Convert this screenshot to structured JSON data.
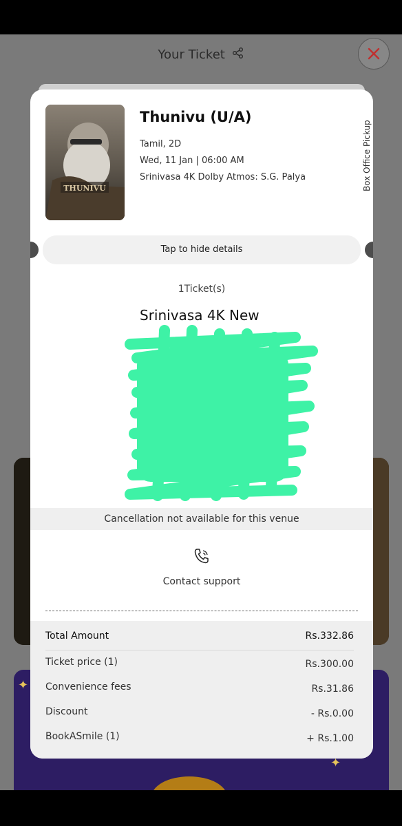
{
  "header": {
    "title": "Your Ticket"
  },
  "movie": {
    "title": "Thunivu (U/A)",
    "language_format": "Tamil, 2D",
    "datetime": "Wed, 11 Jan | 06:00 AM",
    "venue": "Srinivasa 4K Dolby Atmos: S.G. Palya",
    "pickup": "Box Office Pickup",
    "poster_text": "THUNIVU"
  },
  "details": {
    "toggle_label": "Tap to hide details",
    "ticket_count": "1Ticket(s)",
    "venue_short": "Srinivasa 4K New",
    "cancellation_note": "Cancellation not available for this venue",
    "contact_label": "Contact support"
  },
  "summary": {
    "total_label": "Total Amount",
    "total_value": "Rs.332.86",
    "items": [
      {
        "label": "Ticket price (1)",
        "value": "Rs.300.00"
      },
      {
        "label": "Convenience fees",
        "value": "Rs.31.86"
      },
      {
        "label": "Discount",
        "value": "- Rs.0.00"
      },
      {
        "label": "BookASmile (1)",
        "value": "+ Rs.1.00"
      }
    ]
  },
  "colors": {
    "scribble": "#3ef2a6",
    "close": "#c0302f"
  }
}
